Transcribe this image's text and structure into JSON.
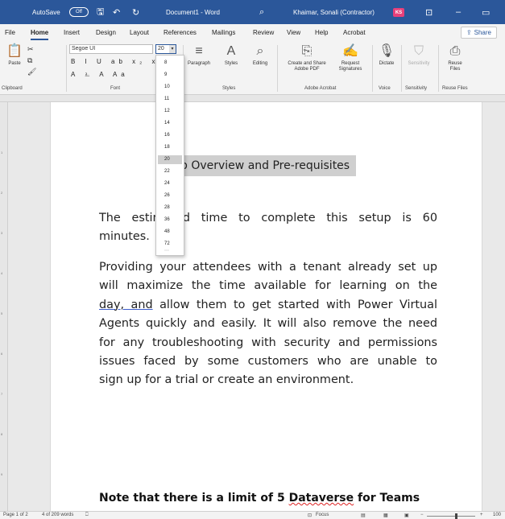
{
  "titlebar": {
    "autosave_label": "AutoSave",
    "autosave_state": "Off",
    "save_icon": "save-icon",
    "undo_icon": "undo-icon",
    "redo_icon": "redo-icon",
    "document_title": "Document1 - Word",
    "user_name": "Khaimar, Sonali (Contractor)",
    "user_initials": "KS",
    "accent_color": "#2b579a"
  },
  "tabs": {
    "items": [
      "File",
      "Home",
      "Insert",
      "Design",
      "Layout",
      "References",
      "Mailings",
      "Review",
      "View",
      "Help",
      "Acrobat"
    ],
    "active": "Home",
    "share_label": "Share"
  },
  "ribbon": {
    "paste_label": "Paste",
    "font_name": "Segoe UI",
    "font_size": "20",
    "format_glyphs": "B I U ab x₂ x²",
    "paragraph_label": "Paragraph",
    "styles_label": "Styles",
    "editing_label": "Editing",
    "create_pdf_label": "Create and Share Adobe PDF",
    "request_signatures_label": "Request Signatures",
    "dictate_label": "Dictate",
    "sensitivity_label": "Sensitivity",
    "reuse_files_label": "Reuse Files",
    "groups": {
      "clipboard": "Clipboard",
      "font": "Font",
      "styles": "Styles",
      "adobe": "Adobe Acrobat",
      "voice": "Voice",
      "sensitivity": "Sensitivity",
      "reuse": "Reuse Files"
    }
  },
  "font_size_menu": {
    "options": [
      "8",
      "9",
      "10",
      "11",
      "12",
      "14",
      "16",
      "18",
      "20",
      "22",
      "24",
      "26",
      "28",
      "36",
      "48",
      "72"
    ],
    "selected": "20"
  },
  "document": {
    "heading": "Setup Overview and Pre-requisites",
    "heading_visible": "p Overview and Pre-requisites",
    "para1_lines": [
      "The estimated time to complete this setup is 60",
      "minutes."
    ],
    "para2_lines": [
      "Providing your attendees with a tenant already set up",
      "will maximize the time available for learning on the",
      "allow them to get started with Power Virtual",
      "Agents quickly and easily. It will also remove the need",
      "for any troubleshooting with security and permissions",
      "issues faced by some customers who are unable to",
      "sign up for a trial or create an environment."
    ],
    "para2_underlined": "day, and",
    "note_prefix": "Note that there is a limit of 5 ",
    "note_misspelled": "Dataverse",
    "note_suffix": " for Teams"
  },
  "statusbar": {
    "page": "Page 1 of 2",
    "words": "4 of 209 words",
    "focus_label": "Focus",
    "zoom": "100"
  }
}
